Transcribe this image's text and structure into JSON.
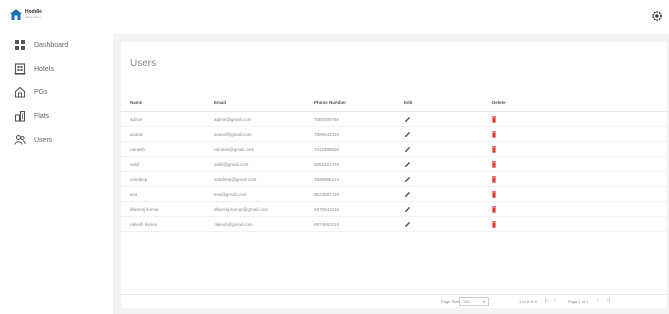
{
  "app": {
    "logo_name": "Hoddle",
    "logo_sub": "hotel admin"
  },
  "sidebar": {
    "items": [
      {
        "label": "Dashboard",
        "icon": "dashboard-icon"
      },
      {
        "label": "Hotels",
        "icon": "hotel-icon"
      },
      {
        "label": "PGs",
        "icon": "pg-icon"
      },
      {
        "label": "Flats",
        "icon": "flats-icon"
      },
      {
        "label": "Users",
        "icon": "users-icon"
      }
    ]
  },
  "page": {
    "title": "Users"
  },
  "table": {
    "headers": {
      "name": "Name",
      "email": "Email",
      "phone": "Phone Number",
      "edit": "Edit",
      "delete": "Delete"
    },
    "rows": [
      {
        "name": "admin",
        "email": "admin@gmail.com",
        "phone": "7000000750"
      },
      {
        "name": "anand",
        "email": "anand@gmail.com",
        "phone": "7896542310"
      },
      {
        "name": "ramesh",
        "email": "ramesh@gmail.com",
        "phone": "7412589630"
      },
      {
        "name": "sahil",
        "email": "sahil@gmail.com",
        "phone": "9856321470"
      },
      {
        "name": "sandeep",
        "email": "sandeep@gmail.com",
        "phone": "7536985214"
      },
      {
        "name": "test",
        "email": "test@gmail.com",
        "phone": "8523697410"
      },
      {
        "name": "dheeraj kumar",
        "email": "dheeraj.kumar@gmail.com",
        "phone": "9876543210"
      },
      {
        "name": "rakesh kumar",
        "email": "rakesh@gmail.com",
        "phone": "9874563210"
      }
    ],
    "edit_icon": "pencil-icon",
    "delete_icon": "trash-icon",
    "accent_delete": "#e53935"
  },
  "pagination": {
    "page_size_label": "Page Size:",
    "page_size_value": "100",
    "range_text": "1 to 8 of 8",
    "page_text": "Page 1 of 1"
  }
}
